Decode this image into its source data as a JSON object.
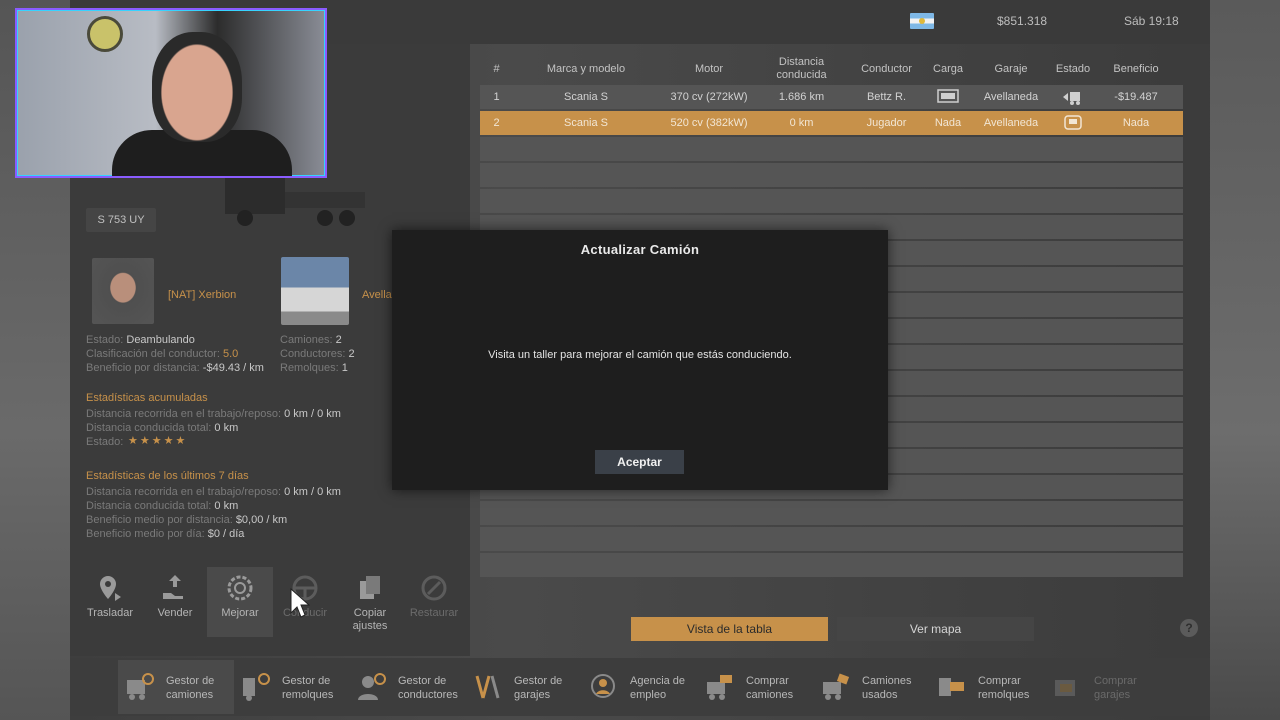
{
  "topbar": {
    "money": "$851.318",
    "clock": "Sáb 19:18",
    "flag": "argentina-flag-icon"
  },
  "truck": {
    "plate": "S 753 UY"
  },
  "driver": {
    "name": "[NAT] Xerbion"
  },
  "garage": {
    "name": "Avella"
  },
  "driver_stats": {
    "estado_label": "Estado:",
    "estado_value": "Deambulando",
    "clasif_label": "Clasificación del conductor:",
    "clasif_value": "5.0",
    "benef_label": "Beneficio por distancia:",
    "benef_value": "-$49.43 / km"
  },
  "garage_stats": {
    "camiones_label": "Camiones:",
    "camiones_value": "2",
    "conductores_label": "Conductores:",
    "conductores_value": "2",
    "remolques_label": "Remolques:",
    "remolques_value": "1"
  },
  "accum": {
    "title": "Estadísticas acumuladas",
    "dist_label": "Distancia recorrida en el trabajo/reposo:",
    "dist_value": "0 km / 0 km",
    "total_label": "Distancia conducida total:",
    "total_value": "0 km",
    "estado_label": "Estado:",
    "stars": "★★★★★"
  },
  "last7": {
    "title": "Estadísticas de los últimos 7 días",
    "dist_label": "Distancia recorrida en el trabajo/reposo:",
    "dist_value": "0 km / 0 km",
    "total_label": "Distancia conducida total:",
    "total_value": "0 km",
    "bdist_label": "Beneficio medio por distancia:",
    "bdist_value": "$0,00 / km",
    "bday_label": "Beneficio medio por día:",
    "bday_value": "$0 / día"
  },
  "actions": [
    {
      "label": "Trasladar",
      "icon": "map-pin-icon"
    },
    {
      "label": "Vender",
      "icon": "sell-hand-icon"
    },
    {
      "label": "Mejorar",
      "icon": "gear-upgrade-icon"
    },
    {
      "label": "Conducir",
      "icon": "steering-wheel-icon"
    },
    {
      "label": "Copiar ajustes",
      "icon": "copy-icon"
    },
    {
      "label": "Restaurar",
      "icon": "wrench-icon"
    }
  ],
  "table": {
    "headers": [
      "#",
      "Marca y modelo",
      "Motor",
      "Distancia conducida",
      "Conductor",
      "Carga",
      "Garaje",
      "Estado",
      "Beneficio"
    ],
    "rows": [
      {
        "num": "1",
        "model": "Scania S",
        "motor": "370 cv (272kW)",
        "dist": "1.686 km",
        "driver": "Bettz R.",
        "cargo_icon": "trailer-icon",
        "garage": "Avellaneda",
        "status_icon": "truck-moving-icon",
        "profit": "-$19.487"
      },
      {
        "num": "2",
        "model": "Scania S",
        "motor": "520 cv (382kW)",
        "dist": "0 km",
        "driver": "Jugador",
        "cargo": "Nada",
        "garage": "Avellaneda",
        "status_icon": "truck-parked-icon",
        "profit": "Nada"
      }
    ]
  },
  "view": {
    "table": "Vista de la tabla",
    "map": "Ver mapa",
    "help": "?"
  },
  "nav": [
    {
      "label": "Gestor de camiones",
      "icon": "truck-gear-icon"
    },
    {
      "label": "Gestor de remolques",
      "icon": "trailer-gear-icon"
    },
    {
      "label": "Gestor de conductores",
      "icon": "driver-gear-icon"
    },
    {
      "label": "Gestor de garajes",
      "icon": "garage-icon"
    },
    {
      "label": "Agencia de empleo",
      "icon": "agency-icon"
    },
    {
      "label": "Comprar camiones",
      "icon": "buy-truck-icon"
    },
    {
      "label": "Camiones usados",
      "icon": "used-truck-icon"
    },
    {
      "label": "Comprar remolques",
      "icon": "buy-trailer-icon"
    },
    {
      "label": "Comprar garajes",
      "icon": "buy-garage-icon"
    }
  ],
  "modal": {
    "title": "Actualizar Camión",
    "message": "Visita un taller para mejorar el camión que estás conduciendo.",
    "button": "Aceptar"
  }
}
